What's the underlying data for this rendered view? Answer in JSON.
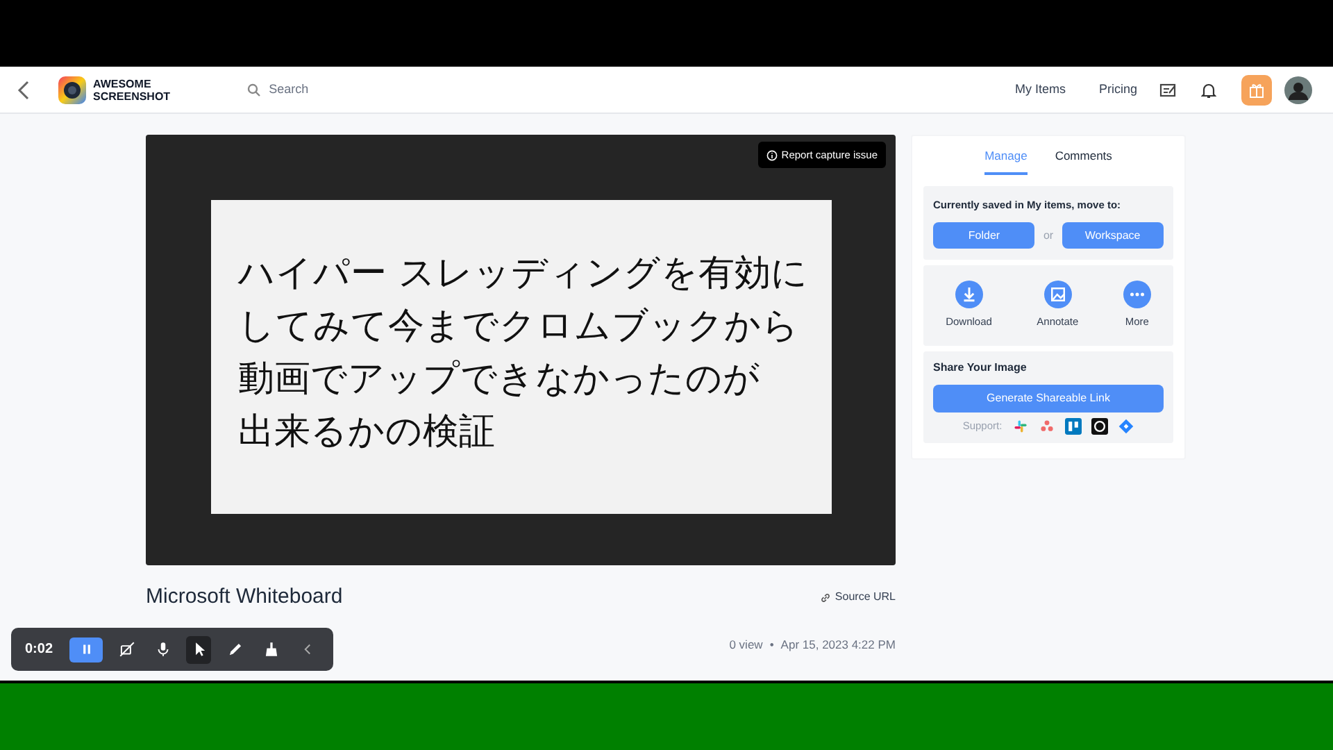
{
  "header": {
    "logo_lines": [
      "AWESOME",
      "SCREENSHOT"
    ],
    "search": {
      "placeholder": "Search"
    },
    "nav": [
      "My Items",
      "Pricing"
    ]
  },
  "viewer": {
    "report_button": "Report capture issue",
    "whiteboard_lines": [
      "ハイパー スレッディングを有効に",
      "してみて今までクロムブックから",
      "動画でアップできなかったのが",
      "出来るかの検証"
    ]
  },
  "item": {
    "title": "Microsoft Whiteboard",
    "source_link": "Source URL",
    "views": "0 view",
    "separator": "•",
    "date": "Apr 15, 2023 4:22 PM"
  },
  "panel": {
    "tabs": [
      {
        "label": "Manage",
        "selected": true
      },
      {
        "label": "Comments",
        "selected": false
      }
    ],
    "move": {
      "label": "Currently saved in My items, move to:",
      "buttons": [
        "Folder",
        "Workspace"
      ],
      "or": "or"
    },
    "actions": [
      {
        "kind": "download",
        "label": "Download"
      },
      {
        "kind": "annotate",
        "label": "Annotate"
      },
      {
        "kind": "more",
        "label": "More"
      }
    ],
    "share": {
      "title": "Share Your Image",
      "button": "Generate Shareable Link",
      "support_label": "Support:",
      "integrations": [
        {
          "kind": "slack"
        },
        {
          "kind": "asana"
        },
        {
          "kind": "trello"
        },
        {
          "kind": "github"
        },
        {
          "kind": "jira"
        }
      ]
    }
  },
  "recorder": {
    "time": "0:02",
    "tools": [
      {
        "kind": "pause",
        "selected": true
      },
      {
        "kind": "camera",
        "selected": false
      },
      {
        "kind": "mic",
        "selected": false
      },
      {
        "kind": "pointer",
        "selected": true
      },
      {
        "kind": "pen",
        "selected": false
      },
      {
        "kind": "eraser",
        "selected": false
      },
      {
        "kind": "collapse",
        "selected": false
      }
    ]
  }
}
